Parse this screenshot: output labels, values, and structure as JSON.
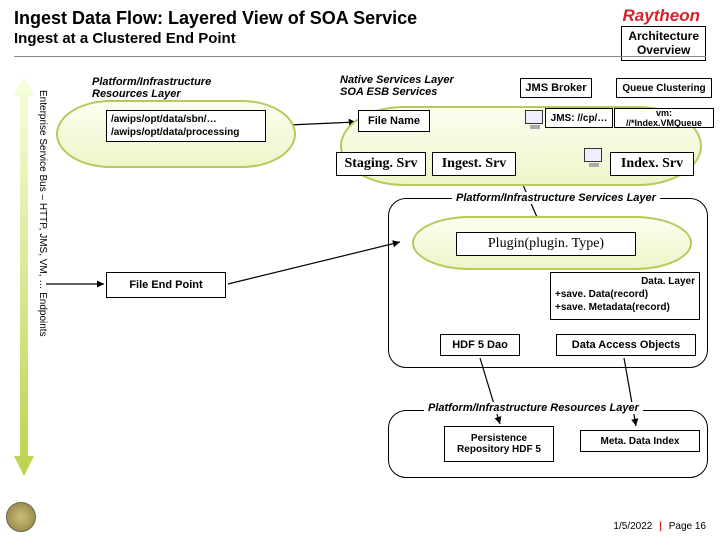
{
  "header": {
    "title": "Ingest Data Flow:  Layered View of SOA Service",
    "subtitle": "Ingest at a Clustered End Point",
    "logo": "Raytheon",
    "arch_line1": "Architecture",
    "arch_line2": "Overview"
  },
  "vertical_label": "Enterprise Service Bus – HTTP, JMS, VM, … Endpoints",
  "platform_layer_label": "Platform/Infrastructure\nResources Layer",
  "native_layer_label": "Native Services Layer\nSOA ESB Services",
  "paths": {
    "line1": "/awips/opt/data/sbn/…",
    "line2": "/awips/opt/data/processing"
  },
  "boxes": {
    "jms_broker": "JMS Broker",
    "queue_clustering": "Queue Clustering",
    "file_name": "File Name",
    "jms_cp": "JMS: //cp/…",
    "vm_queue": "vm: //*Index.VMQueue",
    "staging": "Staging. Srv",
    "ingest": "Ingest. Srv",
    "index": "Index. Srv",
    "file_endpoint": "File End Point",
    "services_layer": "Platform/Infrastructure Services Layer",
    "resources_layer": "Platform/Infrastructure Resources Layer",
    "plugin": "Plugin(plugin. Type)",
    "data_layer_l1": "Data. Layer",
    "data_layer_l2": "+save. Data(record)",
    "data_layer_l3": "+save. Metadata(record)",
    "hdf5dao": "HDF 5 Dao",
    "dao": "Data Access Objects",
    "persistence": "Persistence\nRepository HDF 5",
    "meta_index": "Meta. Data Index"
  },
  "footer": {
    "date": "1/5/2022",
    "page": "Page 16"
  }
}
